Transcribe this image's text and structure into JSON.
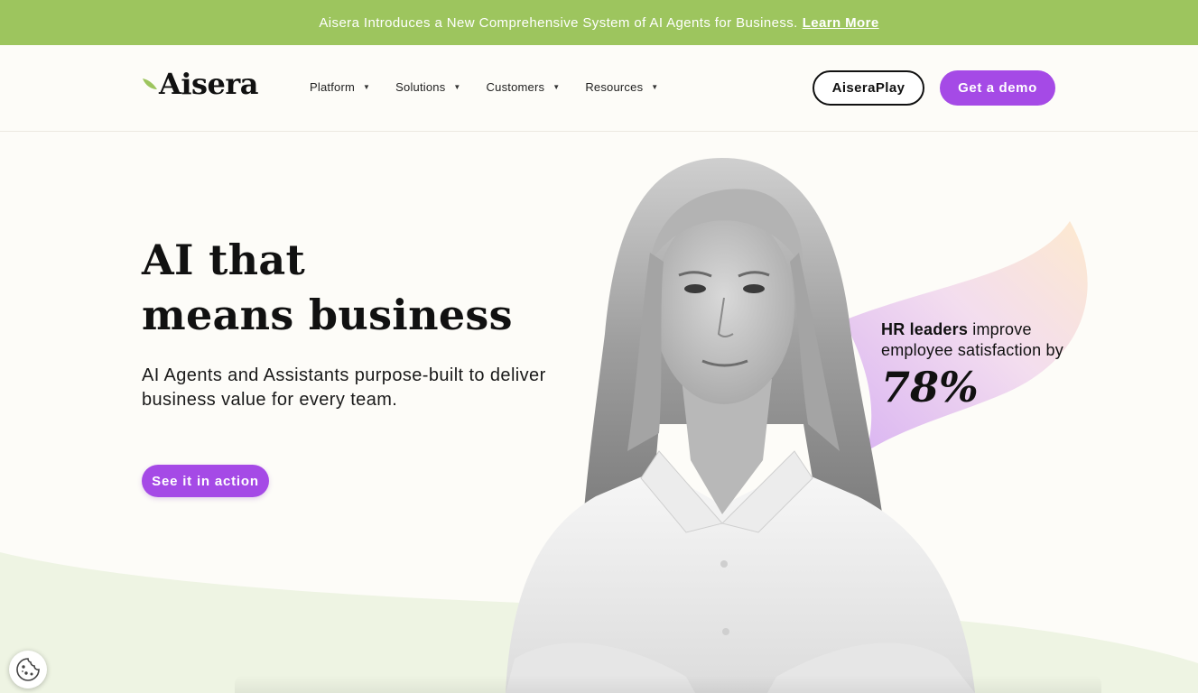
{
  "announcement": {
    "text": "Aisera Introduces a New Comprehensive System of AI Agents for Business.",
    "link": "Learn More"
  },
  "header": {
    "logo": "Aisera",
    "nav": [
      {
        "label": "Platform"
      },
      {
        "label": "Solutions"
      },
      {
        "label": "Customers"
      },
      {
        "label": "Resources"
      }
    ],
    "aiseraplay": "AiseraPlay",
    "demo": "Get a demo"
  },
  "hero": {
    "title_line1": "AI that",
    "title_line2": "means business",
    "subtitle": "AI Agents and Assistants purpose-built to deliver business value for every team.",
    "cta": "See it in action"
  },
  "stat": {
    "bold": "HR leaders",
    "rest": " improve employee satisfaction by",
    "value": "78%"
  },
  "colors": {
    "banner": "#9dc55e",
    "accent": "#a54ae6",
    "background": "#fdfcf8",
    "wave": "#eef4e3"
  },
  "icons": {
    "cookie": "cookie-icon",
    "caret": "caret-down-icon",
    "logo_leaf": "leaf-icon"
  }
}
